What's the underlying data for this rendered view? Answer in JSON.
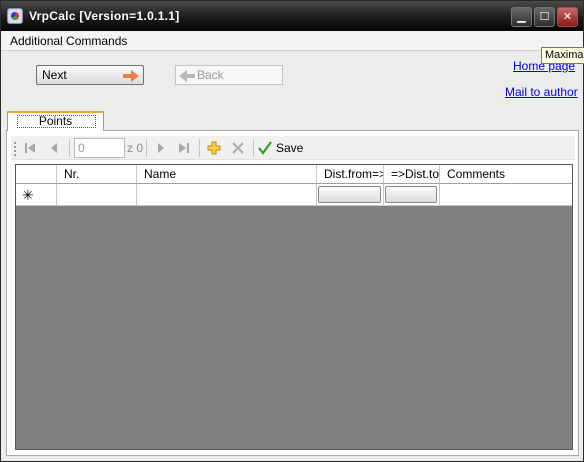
{
  "window": {
    "title": "VrpCalc [Version=1.0.1.1]"
  },
  "menu": {
    "items": [
      "Additional Commands"
    ]
  },
  "tooltip": {
    "text": "Maximali"
  },
  "nav": {
    "next_label": "Next",
    "back_label": "Back"
  },
  "links": {
    "home": "Home page",
    "mail": "Mail to author"
  },
  "tabs": [
    {
      "label": "Points",
      "selected": true
    }
  ],
  "navigator": {
    "position_value": "0",
    "count_label": "z 0",
    "save_label": "Save"
  },
  "grid": {
    "columns": [
      "",
      "Nr.",
      "Name",
      "Dist.from=>",
      "=>Dist.to",
      "Comments"
    ],
    "new_row_marker": "✳"
  },
  "colors": {
    "titlebar": "#1c1c1c",
    "tab_accent": "#f0a830",
    "link": "#0000ee",
    "grid_empty": "#808080",
    "next_arrow": "#f08040"
  }
}
